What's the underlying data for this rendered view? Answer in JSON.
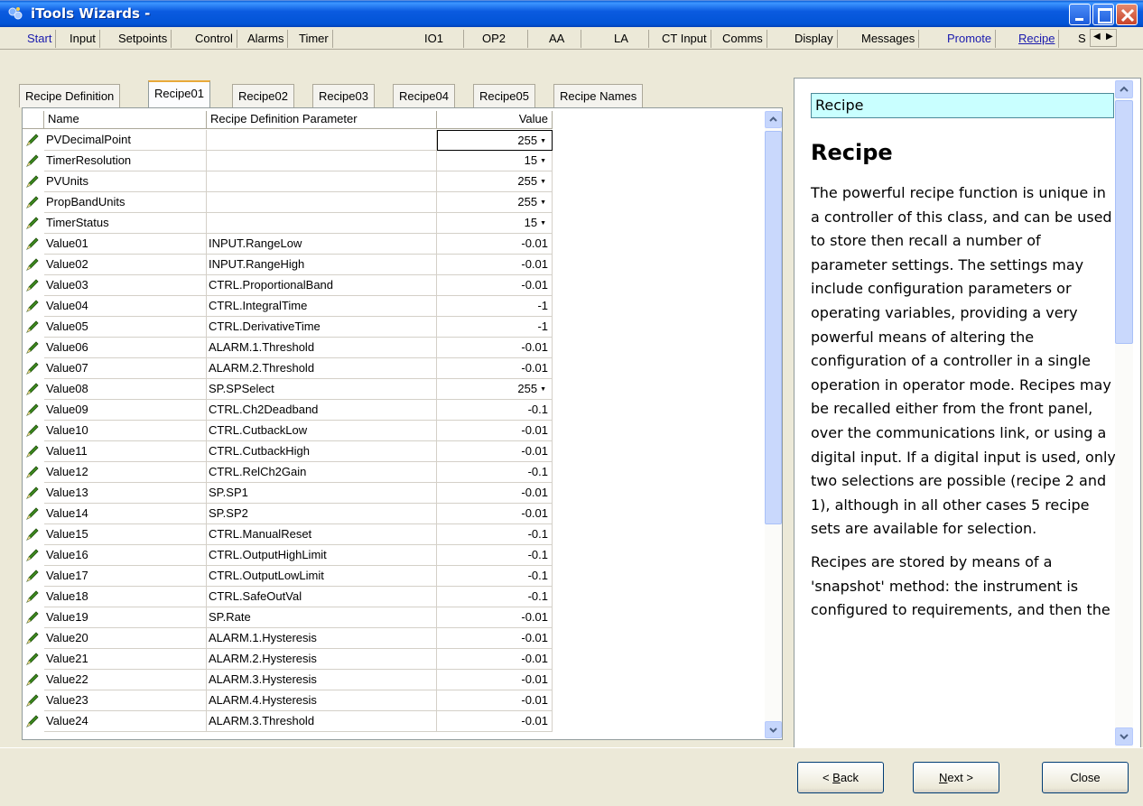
{
  "window": {
    "title": "iTools Wizards -"
  },
  "top_tabs": [
    {
      "label": "Start",
      "link": true
    },
    {
      "label": "Input"
    },
    {
      "label": "Setpoints"
    },
    {
      "label": "Control"
    },
    {
      "label": "Alarms"
    },
    {
      "label": "Timer"
    },
    {
      "label": "IO1"
    },
    {
      "label": "OP2"
    },
    {
      "label": "AA"
    },
    {
      "label": "LA"
    },
    {
      "label": "CT Input"
    },
    {
      "label": "Comms"
    },
    {
      "label": "Display"
    },
    {
      "label": "Messages"
    },
    {
      "label": "Promote",
      "link": true
    },
    {
      "label": "Recipe",
      "link": true,
      "active": true
    },
    {
      "label": "S"
    }
  ],
  "sub_tabs": [
    {
      "label": "Recipe Definition"
    },
    {
      "label": "Recipe01",
      "active": true
    },
    {
      "label": "Recipe02"
    },
    {
      "label": "Recipe03"
    },
    {
      "label": "Recipe04"
    },
    {
      "label": "Recipe05"
    },
    {
      "label": "Recipe Names"
    }
  ],
  "grid": {
    "columns": {
      "name": "Name",
      "param": "Recipe Definition Parameter",
      "value": "Value"
    },
    "rows": [
      {
        "name": "PVDecimalPoint",
        "param": "",
        "value": "255",
        "dropdown": true,
        "selected": true
      },
      {
        "name": "TimerResolution",
        "param": "",
        "value": "15",
        "dropdown": true
      },
      {
        "name": "PVUnits",
        "param": "",
        "value": "255",
        "dropdown": true
      },
      {
        "name": "PropBandUnits",
        "param": "",
        "value": "255",
        "dropdown": true
      },
      {
        "name": "TimerStatus",
        "param": "",
        "value": "15",
        "dropdown": true
      },
      {
        "name": "Value01",
        "param": "INPUT.RangeLow",
        "value": "-0.01"
      },
      {
        "name": "Value02",
        "param": "INPUT.RangeHigh",
        "value": "-0.01"
      },
      {
        "name": "Value03",
        "param": "CTRL.ProportionalBand",
        "value": "-0.01"
      },
      {
        "name": "Value04",
        "param": "CTRL.IntegralTime",
        "value": "-1"
      },
      {
        "name": "Value05",
        "param": "CTRL.DerivativeTime",
        "value": "-1"
      },
      {
        "name": "Value06",
        "param": "ALARM.1.Threshold",
        "value": "-0.01"
      },
      {
        "name": "Value07",
        "param": "ALARM.2.Threshold",
        "value": "-0.01"
      },
      {
        "name": "Value08",
        "param": "SP.SPSelect",
        "value": "255",
        "dropdown": true
      },
      {
        "name": "Value09",
        "param": "CTRL.Ch2Deadband",
        "value": "-0.1"
      },
      {
        "name": "Value10",
        "param": "CTRL.CutbackLow",
        "value": "-0.01"
      },
      {
        "name": "Value11",
        "param": "CTRL.CutbackHigh",
        "value": "-0.01"
      },
      {
        "name": "Value12",
        "param": "CTRL.RelCh2Gain",
        "value": "-0.1"
      },
      {
        "name": "Value13",
        "param": "SP.SP1",
        "value": "-0.01"
      },
      {
        "name": "Value14",
        "param": "SP.SP2",
        "value": "-0.01"
      },
      {
        "name": "Value15",
        "param": "CTRL.ManualReset",
        "value": "-0.1"
      },
      {
        "name": "Value16",
        "param": "CTRL.OutputHighLimit",
        "value": "-0.1"
      },
      {
        "name": "Value17",
        "param": "CTRL.OutputLowLimit",
        "value": "-0.1"
      },
      {
        "name": "Value18",
        "param": "CTRL.SafeOutVal",
        "value": "-0.1"
      },
      {
        "name": "Value19",
        "param": "SP.Rate",
        "value": "-0.01"
      },
      {
        "name": "Value20",
        "param": "ALARM.1.Hysteresis",
        "value": "-0.01"
      },
      {
        "name": "Value21",
        "param": "ALARM.2.Hysteresis",
        "value": "-0.01"
      },
      {
        "name": "Value22",
        "param": "ALARM.3.Hysteresis",
        "value": "-0.01"
      },
      {
        "name": "Value23",
        "param": "ALARM.4.Hysteresis",
        "value": "-0.01"
      },
      {
        "name": "Value24",
        "param": "ALARM.3.Threshold",
        "value": "-0.01"
      }
    ]
  },
  "help": {
    "heading_box": "Recipe",
    "title": "Recipe",
    "paragraphs": [
      "The powerful recipe function is unique in a controller of this class, and can be used to store then recall a number of parameter settings. The settings may include configuration parameters or operating variables, providing a very powerful means of altering the configuration of a controller in a single operation in operator mode. Recipes may be recalled either from the front panel, over the communications link, or using a digital input. If a digital input is used, only two selections are possible (recipe 2 and 1), although in all other cases 5 recipe sets are available for selection.",
      "Recipes are stored by means of a 'snapshot' method: the instrument is configured to requirements, and then the"
    ]
  },
  "buttons": {
    "back": "< Back",
    "next": "Next >",
    "close": "Close"
  },
  "colors": {
    "titlebar": "#0254d6",
    "link": "#1a1aae",
    "help_box": "#c9ffff",
    "pencil": "#3d8a1e"
  }
}
